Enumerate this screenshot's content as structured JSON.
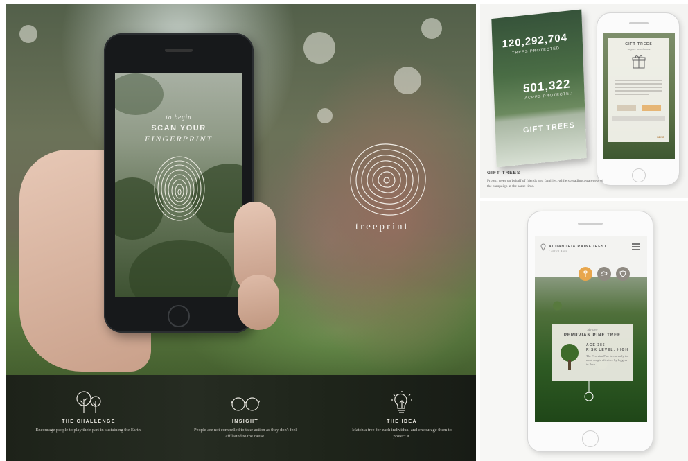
{
  "hero": {
    "phone_sub": "to begin",
    "phone_title": "SCAN YOUR",
    "phone_title2": "FINGERPRINT",
    "brand": "treeprint"
  },
  "strip": {
    "items": [
      {
        "title": "THE CHALLENGE",
        "text": "Encourage people to play their part in sustaining the Earth.",
        "icon": "trees-icon"
      },
      {
        "title": "INSIGHT",
        "text": "People are not compelled to take action as they don't feel affiliated to the cause.",
        "icon": "glasses-icon"
      },
      {
        "title": "THE IDEA",
        "text": "Match a tree for each individual and encourage them to protect it.",
        "icon": "lightbulb-icon"
      }
    ]
  },
  "gift": {
    "count1": "120,292,704",
    "count1_label": "TREES PROTECTED",
    "count2": "501,322",
    "count2_label": "ACRES PROTECTED",
    "banner": "GIFT TREES",
    "card_title": "GIFT TREES",
    "card_sub": "to your loved ones",
    "send": "SEND",
    "section_title": "GIFT TREES",
    "section_desc": "Protect trees on behalf of friends and families, while spreading awareness of the campaign at the same time."
  },
  "map": {
    "location": "ADDANDRIA RAINFOREST",
    "location_sub": "Central Area",
    "card_label": "My tree",
    "tree_name": "PERUVIAN PINE TREE",
    "age": "AGE 385",
    "risk": "RISK LEVEL: HIGH",
    "desc": "The Peruvian Pine is currently the most sought after tree by loggers in Peru."
  },
  "colors": {
    "accent": "#e8a64c",
    "strip_bg": "#1f241b"
  }
}
